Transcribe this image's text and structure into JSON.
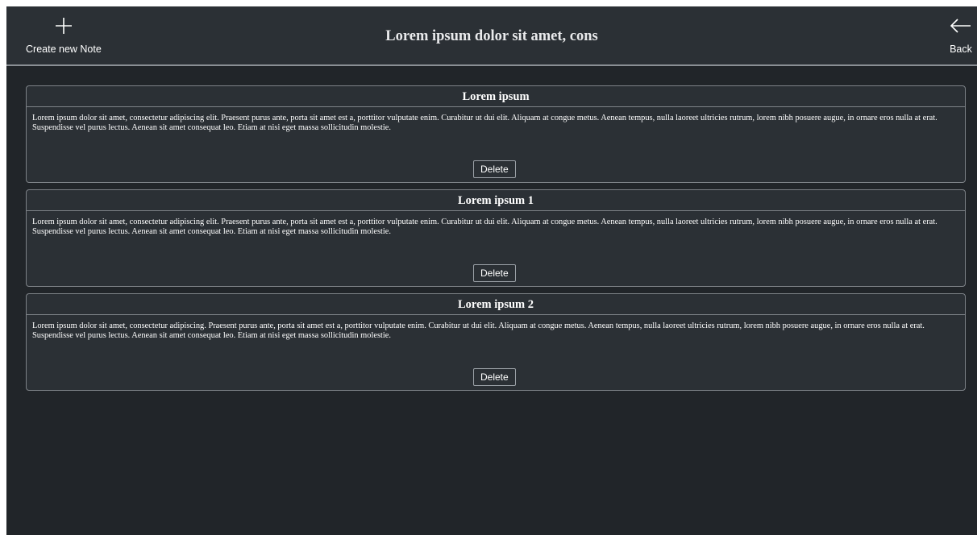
{
  "header": {
    "title": "Lorem ipsum dolor sit amet, cons",
    "create_label": "Create new Note",
    "create_icon": "plus-icon",
    "back_label": "Back",
    "back_icon": "arrow-left-icon"
  },
  "notes": [
    {
      "title": "Lorem ipsum",
      "body": "Lorem ipsum dolor sit amet, consectetur adipiscing elit. Praesent purus ante, porta sit amet est a, porttitor vulputate enim. Curabitur ut dui elit. Aliquam at congue metus. Aenean tempus, nulla laoreet ultricies rutrum, lorem nibh posuere augue, in ornare eros nulla at erat. Suspendisse vel purus lectus. Aenean sit amet consequat leo. Etiam at nisi eget massa sollicitudin molestie.",
      "delete_label": "Delete"
    },
    {
      "title": "Lorem ipsum 1",
      "body": "Lorem ipsum dolor sit amet, consectetur adipiscing elit. Praesent purus ante, porta sit amet est a, porttitor vulputate enim. Curabitur ut dui elit. Aliquam at congue metus. Aenean tempus, nulla laoreet ultricies rutrum, lorem nibh posuere augue, in ornare eros nulla at erat. Suspendisse vel purus lectus. Aenean sit amet consequat leo. Etiam at nisi eget massa sollicitudin molestie.",
      "delete_label": "Delete"
    },
    {
      "title": "Lorem ipsum 2",
      "body": "Lorem ipsum dolor sit amet, consectetur adipiscing. Praesent purus ante, porta sit amet est a, porttitor vulputate enim. Curabitur ut dui elit. Aliquam at congue metus. Aenean tempus, nulla laoreet ultricies rutrum, lorem nibh posuere augue, in ornare eros nulla at erat. Suspendisse vel purus lectus. Aenean sit amet consequat leo. Etiam at nisi eget massa sollicitudin molestie.",
      "delete_label": "Delete"
    }
  ]
}
